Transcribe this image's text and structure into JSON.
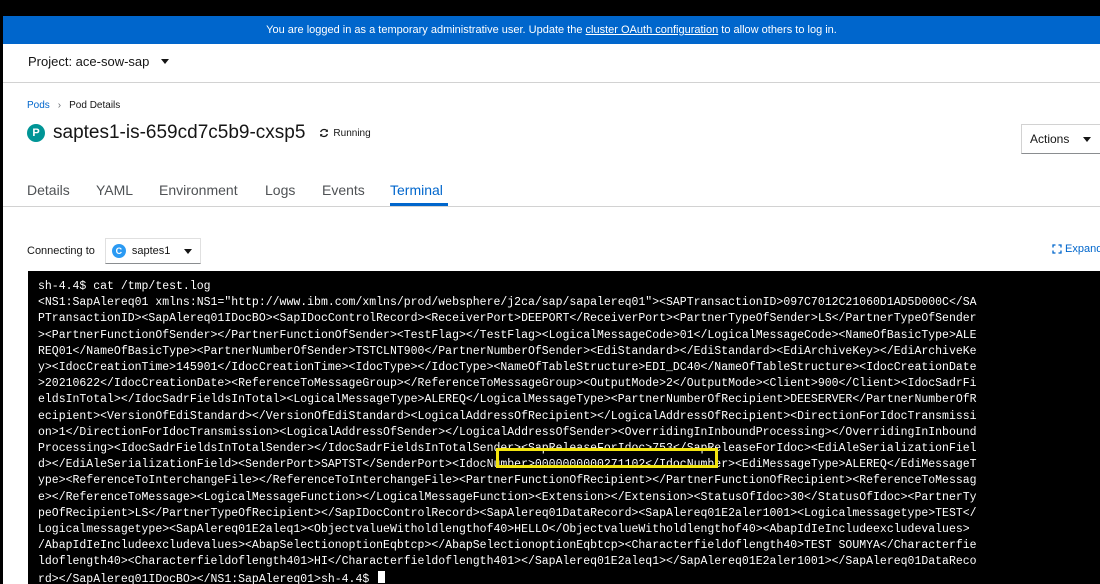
{
  "banner": {
    "text_before": "You are logged in as a temporary administrative user. Update the ",
    "link": "cluster OAuth configuration",
    "text_after": " to allow others to log in."
  },
  "project": {
    "label": "Project: ace-sow-sap"
  },
  "breadcrumb": {
    "pods": "Pods",
    "current": "Pod Details"
  },
  "pod": {
    "badge": "P",
    "name": "saptes1-is-659cd7c5b9-cxsp5",
    "status": "Running"
  },
  "actions": {
    "label": "Actions"
  },
  "tabs": [
    {
      "label": "Details"
    },
    {
      "label": "YAML"
    },
    {
      "label": "Environment"
    },
    {
      "label": "Logs"
    },
    {
      "label": "Events"
    },
    {
      "label": "Terminal"
    }
  ],
  "connect": {
    "label": "Connecting to",
    "badge": "C",
    "container": "saptes1"
  },
  "expand": {
    "label": "Expand"
  },
  "terminal": {
    "lines": [
      "sh-4.4$ cat /tmp/test.log",
      "<NS1:SapAlereq01 xmlns:NS1=\"http://www.ibm.com/xmlns/prod/websphere/j2ca/sap/sapalereq01\"><SAPTransactionID>097C7012C21060D1AD5D000C</SA",
      "PTransactionID><SapAlereq01IDocBO><SapIDocControlRecord><ReceiverPort>DEEPORT</ReceiverPort><PartnerTypeOfSender>LS</PartnerTypeOfSender",
      "><PartnerFunctionOfSender></PartnerFunctionOfSender><TestFlag></TestFlag><LogicalMessageCode>01</LogicalMessageCode><NameOfBasicType>ALE",
      "REQ01</NameOfBasicType><PartnerNumberOfSender>TSTCLNT900</PartnerNumberOfSender><EdiStandard></EdiStandard><EdiArchiveKey></EdiArchiveKe",
      "y><IdocCreationTime>145901</IdocCreationTime><IdocType></IdocType><NameOfTableStructure>EDI_DC40</NameOfTableStructure><IdocCreationDate",
      ">20210622</IdocCreationDate><ReferenceToMessageGroup></ReferenceToMessageGroup><OutputMode>2</OutputMode><Client>900</Client><IdocSadrFi",
      "eldsInTotal></IdocSadrFieldsInTotal><LogicalMessageType>ALEREQ</LogicalMessageType><PartnerNumberOfRecipient>DEESERVER</PartnerNumberOfR",
      "ecipient><VersionOfEdiStandard></VersionOfEdiStandard><LogicalAddressOfRecipient></LogicalAddressOfRecipient><DirectionForIdocTransmissi",
      "on>1</DirectionForIdocTransmission><LogicalAddressOfSender></LogicalAddressOfSender><OverridingInInboundProcessing></OverridingInInbound",
      "Processing><IdocSadrFieldsInTotalSender></IdocSadrFieldsInTotalSender><SapReleaseForIdoc>753</SapReleaseForIdoc><EdiAleSerializationFiel",
      "d></EdiAleSerializationField><SenderPort>SAPTST</SenderPort><IdocNumber>0000000000271102</IdocNumber><EdiMessageType>ALEREQ</EdiMessageT",
      "ype><ReferenceToInterchangeFile></ReferenceToInterchangeFile><PartnerFunctionOfRecipient></PartnerFunctionOfRecipient><ReferenceToMessag",
      "e></ReferenceToMessage><LogicalMessageFunction></LogicalMessageFunction><Extension></Extension><StatusOfIdoc>30</StatusOfIdoc><PartnerTy",
      "peOfRecipient>LS</PartnerTypeOfRecipient></SapIDocControlRecord><SapAlereq01DataRecord><SapAlereq01E2aler1001><Logicalmessagetype>TEST</",
      "Logicalmessagetype><SapAlereq01E2aleq1><ObjectvalueWitholdlengthof40>HELLO</ObjectvalueWitholdlengthof40><AbapIdIeIncludeexcludevalues>",
      "/AbapIdIeIncludeexcludevalues><AbapSelectionoptionEqbtcp></AbapSelectionoptionEqbtcp><Characterfieldoflength40>TEST SOUMYA</Characterfie",
      "ldoflength40><Characterfieldoflength401>HI</Characterfieldoflength401></SapAlereq01E2aleq1></SapAlereq01E2aler1001></SapAlereq01DataReco",
      "rd></SapAlereq01IDocBO></NS1:SapAlereq01>sh-4.4$ "
    ]
  }
}
